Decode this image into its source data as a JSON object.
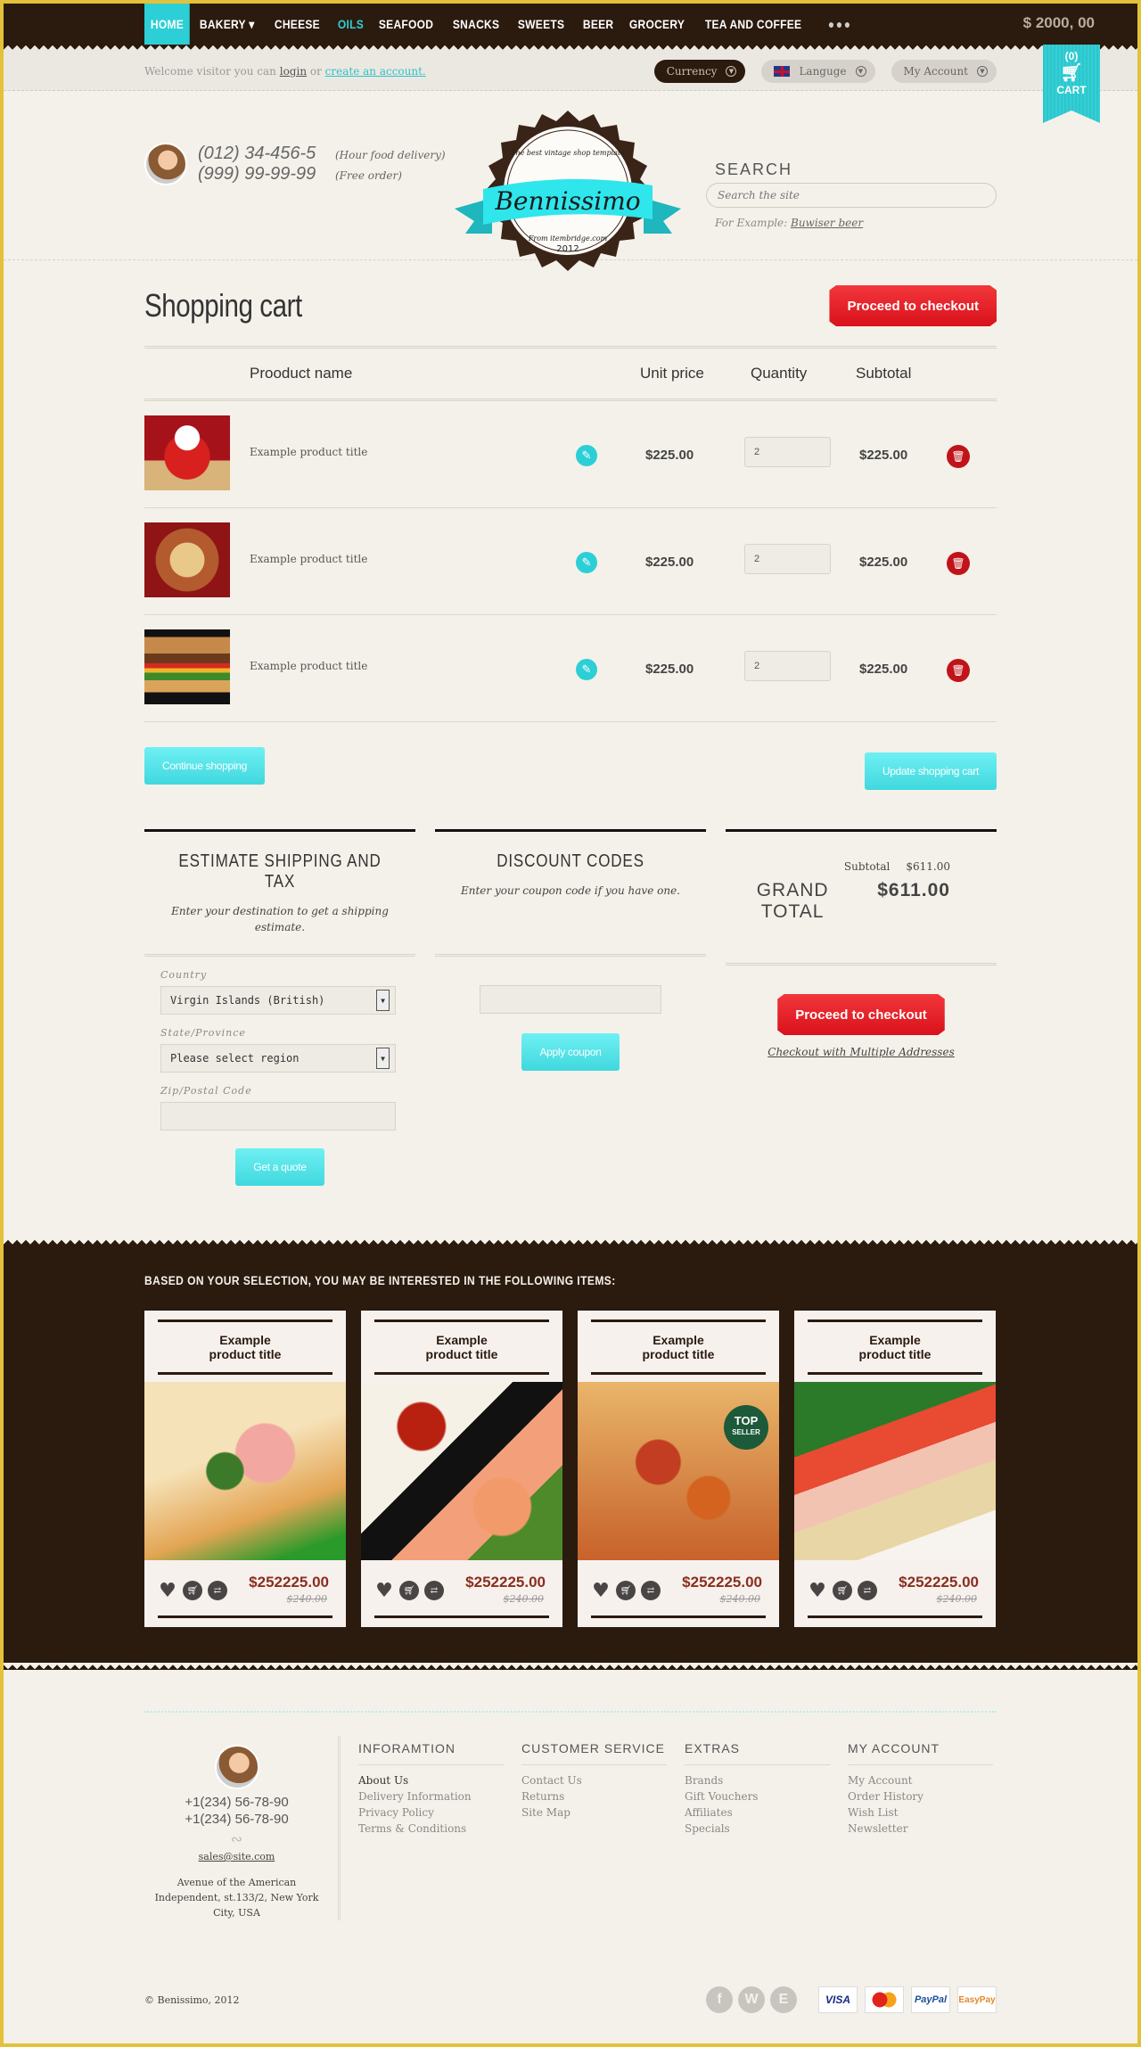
{
  "nav": {
    "items": [
      {
        "label": "HOME",
        "state": "active"
      },
      {
        "label": "BAKERY ▾",
        "state": ""
      },
      {
        "label": "CHEESE",
        "state": ""
      },
      {
        "label": "OILS",
        "state": "hover"
      },
      {
        "label": "SEAFOOD",
        "state": ""
      },
      {
        "label": "SNACKS",
        "state": ""
      },
      {
        "label": "SWEETS",
        "state": ""
      },
      {
        "label": "BEER",
        "state": ""
      },
      {
        "label": "GROCERY",
        "state": ""
      },
      {
        "label": "TEA AND COFFEE",
        "state": ""
      }
    ],
    "more_label": "●●●",
    "balance": "$ 2000, 00"
  },
  "cart_ribbon": {
    "count": "(0)",
    "label": "CART",
    "icon": "cart-icon"
  },
  "welcome": {
    "prefix": "Welcome visitor you can",
    "login": "login",
    "or": "or",
    "create": "create an account."
  },
  "pills": {
    "currency": "Currency",
    "language": "Languge",
    "account": "My Account"
  },
  "contact": {
    "phones": [
      {
        "number": "(012) 34-456-5",
        "note": "(Hour food delivery)"
      },
      {
        "number": "(999) 99-99-99",
        "note": "(Free order)"
      }
    ]
  },
  "logo": {
    "tagline": "The best vintage shop template",
    "name": "Bennissimo",
    "from": "From itembridge.com",
    "year": "2012"
  },
  "search": {
    "title": "SEARCH",
    "placeholder": "Search the site",
    "example_prefix": "For Example:",
    "example_link": "Buwiser beer"
  },
  "cart": {
    "title": "Shopping cart",
    "checkout_label": "Proceed to checkout",
    "columns": {
      "name": "Prooduct name",
      "unit_price": "Unit price",
      "quantity": "Quantity",
      "subtotal": "Subtotal"
    },
    "rows": [
      {
        "title": "Example product title",
        "unit_price": "$225.00",
        "quantity": "2",
        "subtotal": "$225.00",
        "image": "strawberry-tart"
      },
      {
        "title": "Example product title",
        "unit_price": "$225.00",
        "quantity": "2",
        "subtotal": "$225.00",
        "image": "sandwich-platter"
      },
      {
        "title": "Example product title",
        "unit_price": "$225.00",
        "quantity": "2",
        "subtotal": "$225.00",
        "image": "burger"
      }
    ],
    "continue_label": "Continue shopping",
    "update_label": "Update shopping cart"
  },
  "shipping": {
    "title": "ESTIMATE SHIPPING AND TAX",
    "desc": "Enter your destination to get a shipping estimate.",
    "country_label": "Country",
    "country_value": "Virgin Islands (British)",
    "state_label": "State/Province",
    "state_value": "Please select region",
    "zip_label": "Zip/Postal Code",
    "zip_value": "",
    "quote_label": "Get a quote"
  },
  "discount": {
    "title": "DISCOUNT CODES",
    "desc": "Enter your coupon code if you have one.",
    "code_value": "",
    "apply_label": "Apply coupon"
  },
  "totals": {
    "subtotal_label": "Subtotal",
    "subtotal_value": "$611.00",
    "grand_label": "GRAND TOTAL",
    "grand_value": "$611.00",
    "checkout_label": "Proceed to checkout",
    "multi_label": "Checkout with Multiple Addresses"
  },
  "recommendations": {
    "heading": "BASED ON YOUR SELECTION, YOU MAY BE INTERESTED IN THE FOLLOWING ITEMS:",
    "items": [
      {
        "title": "Example product title",
        "price": "$252225.00",
        "old_price": "$240.00",
        "image": "ham-sandwich",
        "badge": ""
      },
      {
        "title": "Example product title",
        "price": "$252225.00",
        "old_price": "$240.00",
        "image": "sushi",
        "badge": ""
      },
      {
        "title": "Example product title",
        "price": "$252225.00",
        "old_price": "$240.00",
        "image": "pizza",
        "badge": "TOP|SELLER"
      },
      {
        "title": "Example product title",
        "price": "$252225.00",
        "old_price": "$240.00",
        "image": "sub-sandwich",
        "badge": ""
      }
    ]
  },
  "footer": {
    "phones": [
      "+1(234) 56-78-90",
      "+1(234) 56-78-90"
    ],
    "email": "sales@site.com",
    "address": "Avenue of the American Independent, st.133/2, New York City, USA",
    "columns": [
      {
        "title": "INFORAMTION",
        "links": [
          "About Us",
          "Delivery Information",
          "Privacy Policy",
          "Terms & Conditions"
        ]
      },
      {
        "title": "CUSTOMER SERVICE",
        "links": [
          "Contact Us",
          "Returns",
          "Site Map"
        ]
      },
      {
        "title": "EXTRAS",
        "links": [
          "Brands",
          "Gift Vouchers",
          "Affiliates",
          "Specials"
        ]
      },
      {
        "title": "MY ACCOUNT",
        "links": [
          "My Account",
          "Order History",
          "Wish List",
          "Newsletter"
        ]
      }
    ],
    "copyright": "© Benissimo, 2012",
    "social": [
      "facebook-icon",
      "wordpress-icon",
      "evernote-icon"
    ],
    "payments": [
      "VISA",
      "MasterCard",
      "PayPal",
      "EasyPay"
    ]
  },
  "colors": {
    "accent": "#2dcfd6",
    "brand_dark": "#2b1a0e",
    "danger": "#d9111b",
    "border": "#e2c23a"
  }
}
